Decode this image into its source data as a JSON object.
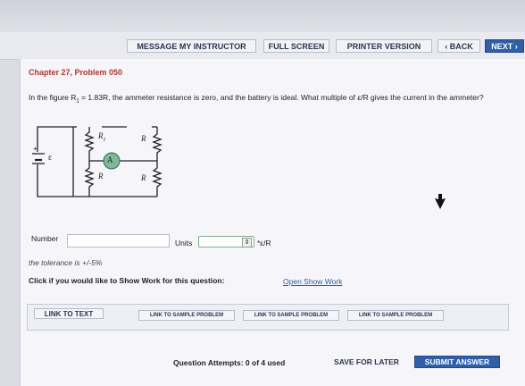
{
  "nav": {
    "message_instructor": "MESSAGE MY INSTRUCTOR",
    "full_screen": "FULL SCREEN",
    "printer_version": "PRINTER VERSION",
    "back": "‹ BACK",
    "next": "NEXT ›"
  },
  "problem": {
    "chapter": "Chapter 27, Problem 050",
    "question_pre": "In the figure R",
    "question_sub": "1",
    "question_post": " = 1.83R, the ammeter resistance is zero, and the battery is ideal. What multiple of ε/R gives the current in the ammeter?"
  },
  "figure": {
    "r1": "R",
    "r1_sub": "1",
    "r_top_right": "R",
    "r_bottom_left": "R",
    "r_bottom_right": "R",
    "ammeter": "A",
    "emf": "ε",
    "plus": "+"
  },
  "answer": {
    "number_label": "Number",
    "number_value": "",
    "units_label": "Units",
    "units_value": "",
    "units_suffix": "*ε/R",
    "tolerance": "the tolerance is +/-5%"
  },
  "show_work": {
    "prompt": "Click if you would like to Show Work for this question:",
    "link": "Open Show Work"
  },
  "links": {
    "link_to_text": "LINK TO TEXT",
    "sample1": "LINK TO SAMPLE PROBLEM",
    "sample2": "LINK TO SAMPLE PROBLEM",
    "sample3": "LINK TO SAMPLE PROBLEM"
  },
  "footer": {
    "attempts": "Question Attempts: 0 of 4 used",
    "save": "SAVE FOR LATER",
    "submit": "SUBMIT ANSWER"
  }
}
